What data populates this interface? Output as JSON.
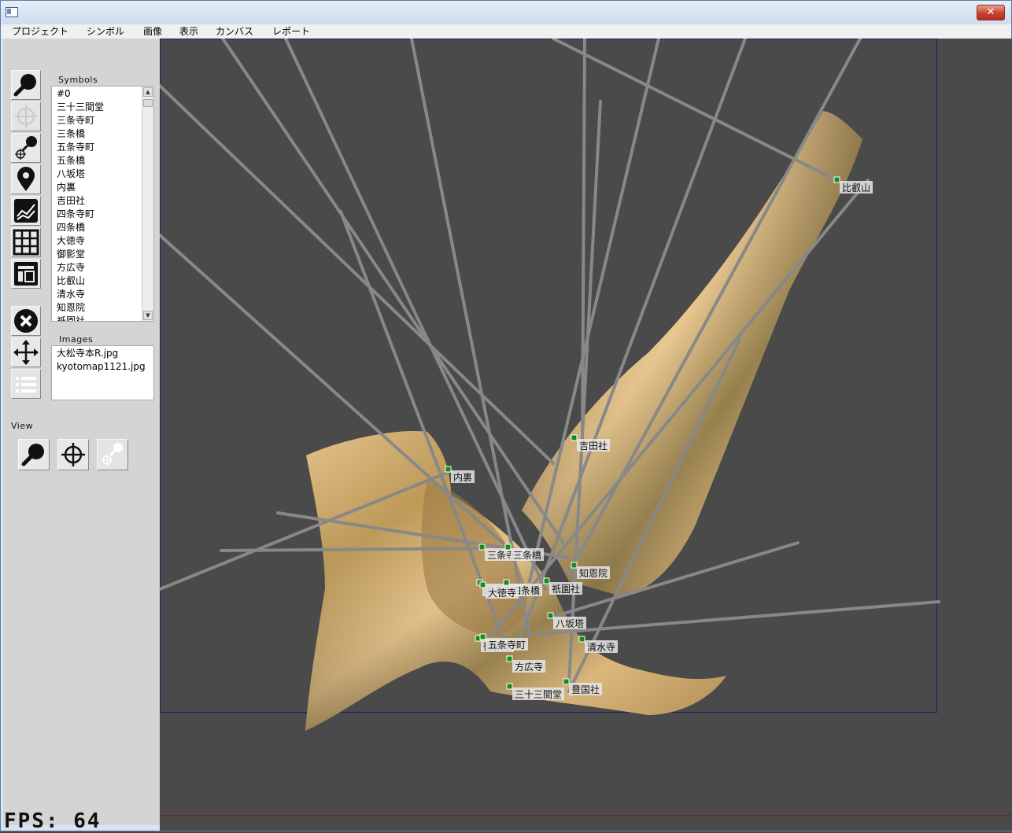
{
  "window": {
    "close_label": "✕"
  },
  "menu": [
    "プロジェクト",
    "シンボル",
    "画像",
    "表示",
    "カンバス",
    "レポート"
  ],
  "sidebar": {
    "symbols_label": "Symbols",
    "symbols": [
      "#0",
      "三十三間堂",
      "三条寺町",
      "三条橋",
      "五条寺町",
      "五条橋",
      "八坂塔",
      "内裏",
      "吉田社",
      "四条寺町",
      "四条橋",
      "大徳寺",
      "御影堂",
      "方広寺",
      "比叡山",
      "清水寺",
      "知恩院",
      "祇園社"
    ],
    "images_label": "Images",
    "images": [
      "大松寺本R.jpg",
      "kyotomap1121.jpg"
    ],
    "view_label": "View"
  },
  "tools": [
    {
      "name": "zoom-tool-icon"
    },
    {
      "name": "crosshair-tool-icon"
    },
    {
      "name": "zoom-target-tool-icon"
    },
    {
      "name": "map-pin-tool-icon"
    },
    {
      "name": "line-chart-tool-icon"
    },
    {
      "name": "grid-tool-icon"
    },
    {
      "name": "layout-tool-icon"
    },
    {
      "name": "delete-tool-icon"
    },
    {
      "name": "move-tool-icon"
    },
    {
      "name": "list-tool-icon"
    }
  ],
  "canvas": {
    "markers": [
      "比叡山",
      "吉田社",
      "内裏",
      "三条寺町",
      "三条橋",
      "四条寺町",
      "四条橋",
      "大徳寺",
      "知恩院",
      "祇園社",
      "八坂塔",
      "清水寺",
      "御影堂",
      "五条寺町",
      "方広寺",
      "三十三間堂",
      "豊国社"
    ]
  },
  "status": {
    "fps": "FPS: 64"
  }
}
